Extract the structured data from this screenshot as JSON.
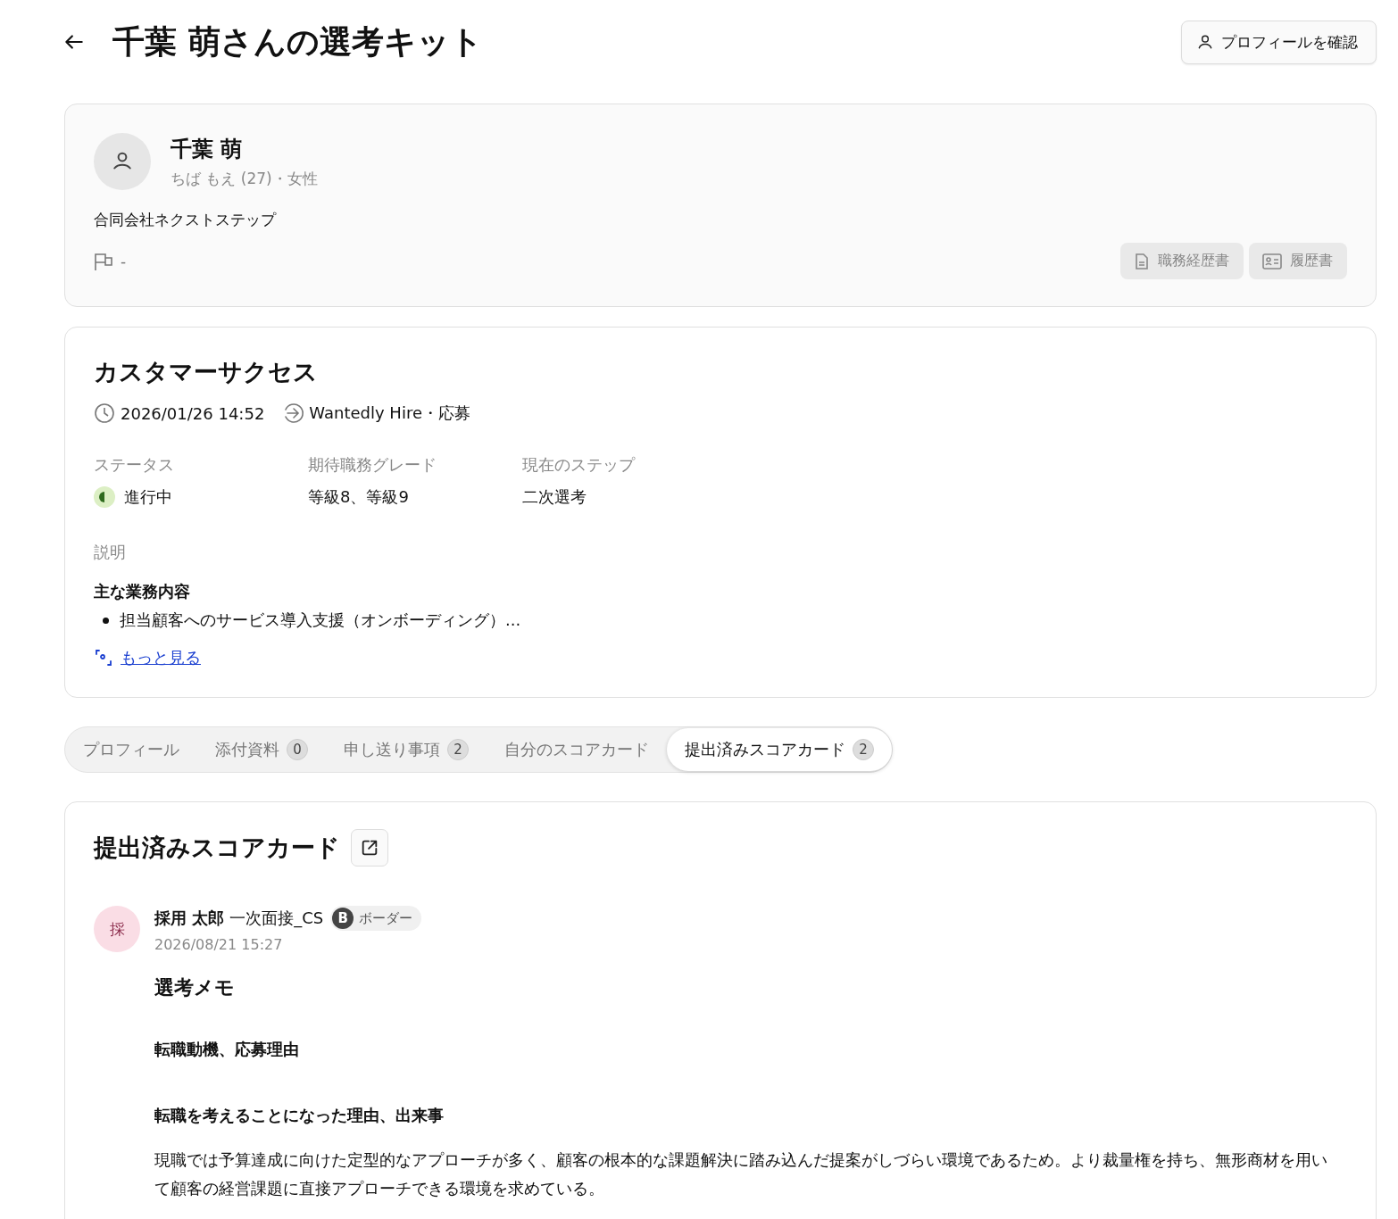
{
  "header": {
    "title": "千葉 萌さんの選考キット",
    "profile_button": "プロフィールを確認"
  },
  "candidate": {
    "name": "千葉 萌",
    "reading": "ちば もえ (27)・女性",
    "company": "合同会社ネクストステップ",
    "flag_value": "-",
    "documents": [
      {
        "label": "職務経歴書",
        "kind": "document",
        "disabled": true
      },
      {
        "label": "履歴書",
        "kind": "id-card",
        "disabled": true
      }
    ]
  },
  "job": {
    "title": "カスタマーサクセス",
    "date": "2026/01/26 14:52",
    "source": "Wantedly Hire・応募",
    "fields": [
      {
        "label": "ステータス",
        "value": "進行中",
        "kind": "status"
      },
      {
        "label": "期待職務グレード",
        "value": "等級8、等級9",
        "kind": "text"
      },
      {
        "label": "現在のステップ",
        "value": "二次選考",
        "kind": "text"
      }
    ],
    "description_label": "説明",
    "description_heading": "主な業務内容",
    "description_items": [
      "担当顧客へのサービス導入支援（オンボーディング）..."
    ],
    "more_link": "もっと見る"
  },
  "tabs": [
    {
      "label": "プロフィール",
      "selected": false
    },
    {
      "label": "添付資料",
      "count": "0",
      "selected": false
    },
    {
      "label": "申し送り事項",
      "count": "2",
      "selected": false
    },
    {
      "label": "自分のスコアカード",
      "selected": false
    },
    {
      "label": "提出済みスコアカード",
      "count": "2",
      "selected": true
    }
  ],
  "scorecards": {
    "title": "提出済みスコアカード",
    "entries": [
      {
        "avatar": "採",
        "name": "採用 太郎",
        "stage": "一次面接_CS",
        "rating_letter": "B",
        "rating_label": "ボーダー",
        "date": "2026/08/21 15:27",
        "blocks": [
          {
            "kind": "title",
            "text": "選考メモ"
          },
          {
            "kind": "heading",
            "text": "転職動機、応募理由"
          },
          {
            "kind": "subheading",
            "text": "転職を考えることになった理由、出来事"
          },
          {
            "kind": "paragraph",
            "text": "現職では予算達成に向けた定型的なアプローチが多く、顧客の根本的な課題解決に踏み込んだ提案がしづらい環境であるため。より裁量権を持ち、無形商材を用いて顧客の経営課題に直接アプローチできる環境を求めている。"
          }
        ]
      }
    ]
  }
}
